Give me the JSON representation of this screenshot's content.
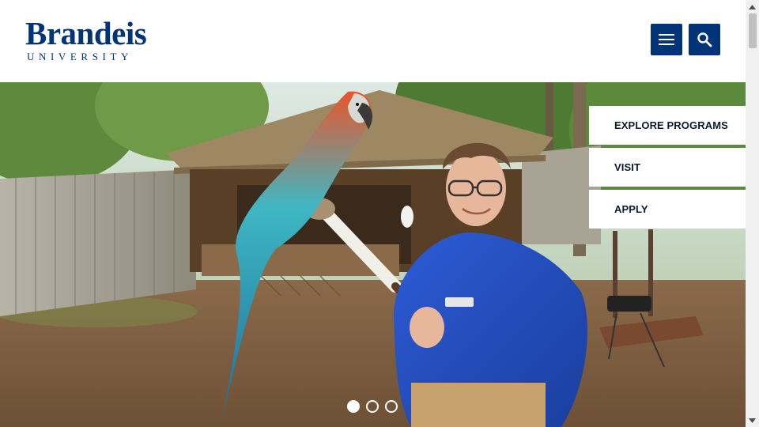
{
  "logo": {
    "wordmark": "Brandeis",
    "subtitle": "UNIVERSITY"
  },
  "header": {
    "menu_icon": "hamburger-icon",
    "search_icon": "search-icon"
  },
  "quick_links": [
    "EXPLORE PROGRAMS",
    "VISIT",
    "APPLY"
  ],
  "hero": {
    "icon": "hero-photo",
    "active_slide": 1,
    "slide_count": 3
  },
  "colors": {
    "brand": "#003478",
    "link_text": "#0b1a2e"
  }
}
